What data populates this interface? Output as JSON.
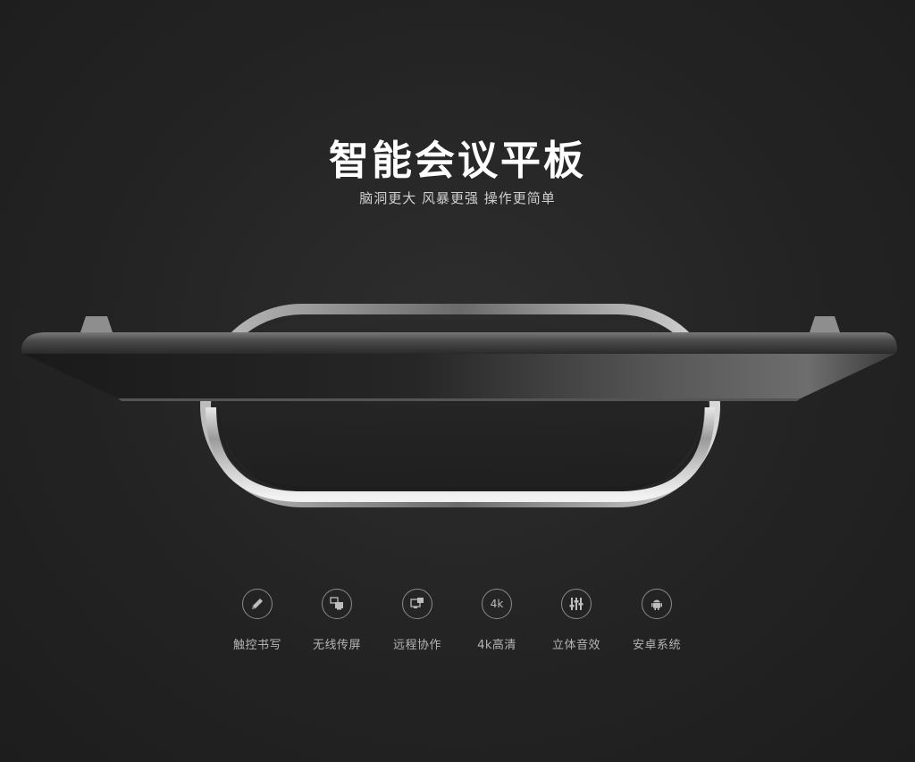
{
  "hero": {
    "title": "智能会议平板",
    "subtitle": "脑洞更大 风暴更强 操作更简单"
  },
  "features": [
    {
      "icon": "pen-icon",
      "label": "触控书写"
    },
    {
      "icon": "screen-cast-icon",
      "label": "无线传屏"
    },
    {
      "icon": "remote-collaboration-icon",
      "label": "远程协作"
    },
    {
      "icon": "4k-icon",
      "label": "4k高清",
      "glyph": "4k"
    },
    {
      "icon": "equalizer-icon",
      "label": "立体音效"
    },
    {
      "icon": "android-icon",
      "label": "安卓系统"
    }
  ],
  "colors": {
    "background": "#232323",
    "title": "#ffffff",
    "subtitle": "#cfcfcf",
    "feature_label": "#b5b5b5",
    "icon_ring": "#8a8a8a"
  }
}
